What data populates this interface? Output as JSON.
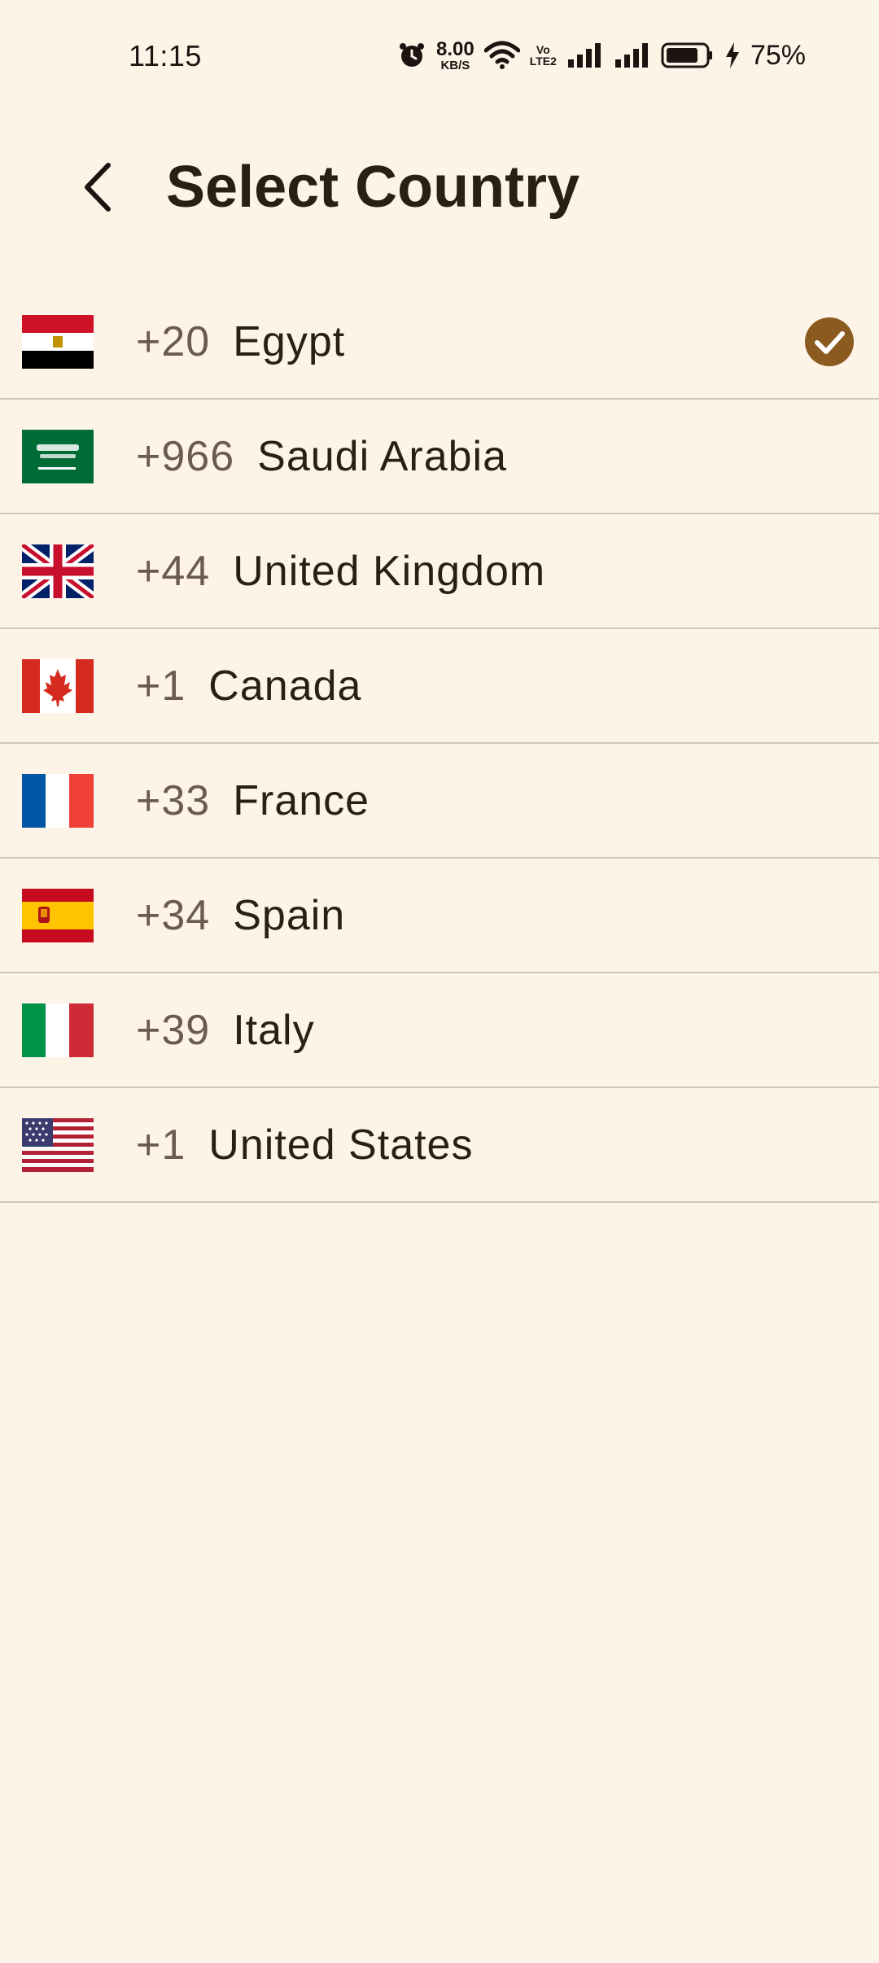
{
  "status_bar": {
    "time": "11:15",
    "net_speed_value": "8.00",
    "net_speed_unit": "KB/S",
    "volte_top": "Vo",
    "volte_bottom": "LTE2",
    "battery_percent": "75%"
  },
  "header": {
    "title": "Select Country",
    "back_icon": "chevron-left-icon"
  },
  "colors": {
    "background": "#fdf3e7",
    "accent": "#8a5a1f",
    "divider": "#cfc6bc",
    "text_primary": "#2a1f14",
    "text_secondary": "#6b5b4f"
  },
  "countries": [
    {
      "code": "+20",
      "name": "Egypt",
      "flag": "egypt-flag-icon",
      "selected": true
    },
    {
      "code": "+966",
      "name": "Saudi Arabia",
      "flag": "saudi-arabia-flag-icon",
      "selected": false
    },
    {
      "code": "+44",
      "name": "United Kingdom",
      "flag": "uk-flag-icon",
      "selected": false
    },
    {
      "code": "+1",
      "name": "Canada",
      "flag": "canada-flag-icon",
      "selected": false
    },
    {
      "code": "+33",
      "name": "France",
      "flag": "france-flag-icon",
      "selected": false
    },
    {
      "code": "+34",
      "name": "Spain",
      "flag": "spain-flag-icon",
      "selected": false
    },
    {
      "code": "+39",
      "name": "Italy",
      "flag": "italy-flag-icon",
      "selected": false
    },
    {
      "code": "+1",
      "name": "United States",
      "flag": "usa-flag-icon",
      "selected": false
    }
  ]
}
